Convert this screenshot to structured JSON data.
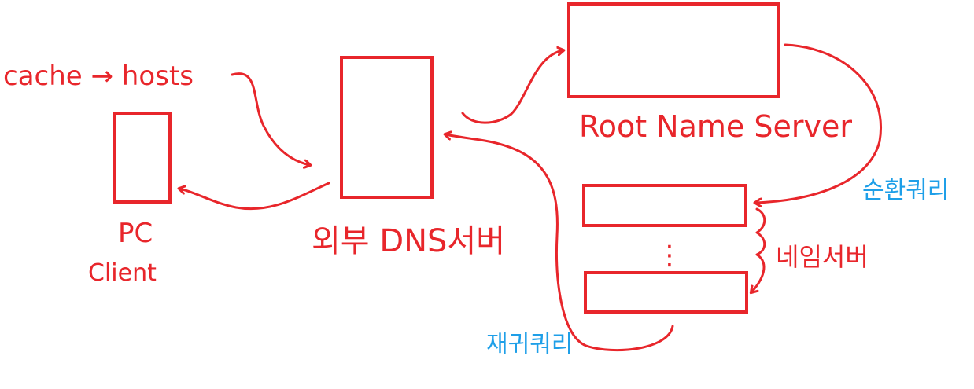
{
  "labels": {
    "cache_note": "cache → hosts",
    "pc_line1": "PC",
    "pc_line2": "Client",
    "local_dns": "외부 DNS서버",
    "root_server": "Root Name Server",
    "ellipsis": "⋮",
    "domain_servers": "네임서버",
    "iterative_query": "순환쿼리",
    "recursive_query": "재귀쿼리"
  },
  "colors": {
    "ink": "#e8262b",
    "note": "#1e9fe8",
    "background": "#ffffff"
  }
}
